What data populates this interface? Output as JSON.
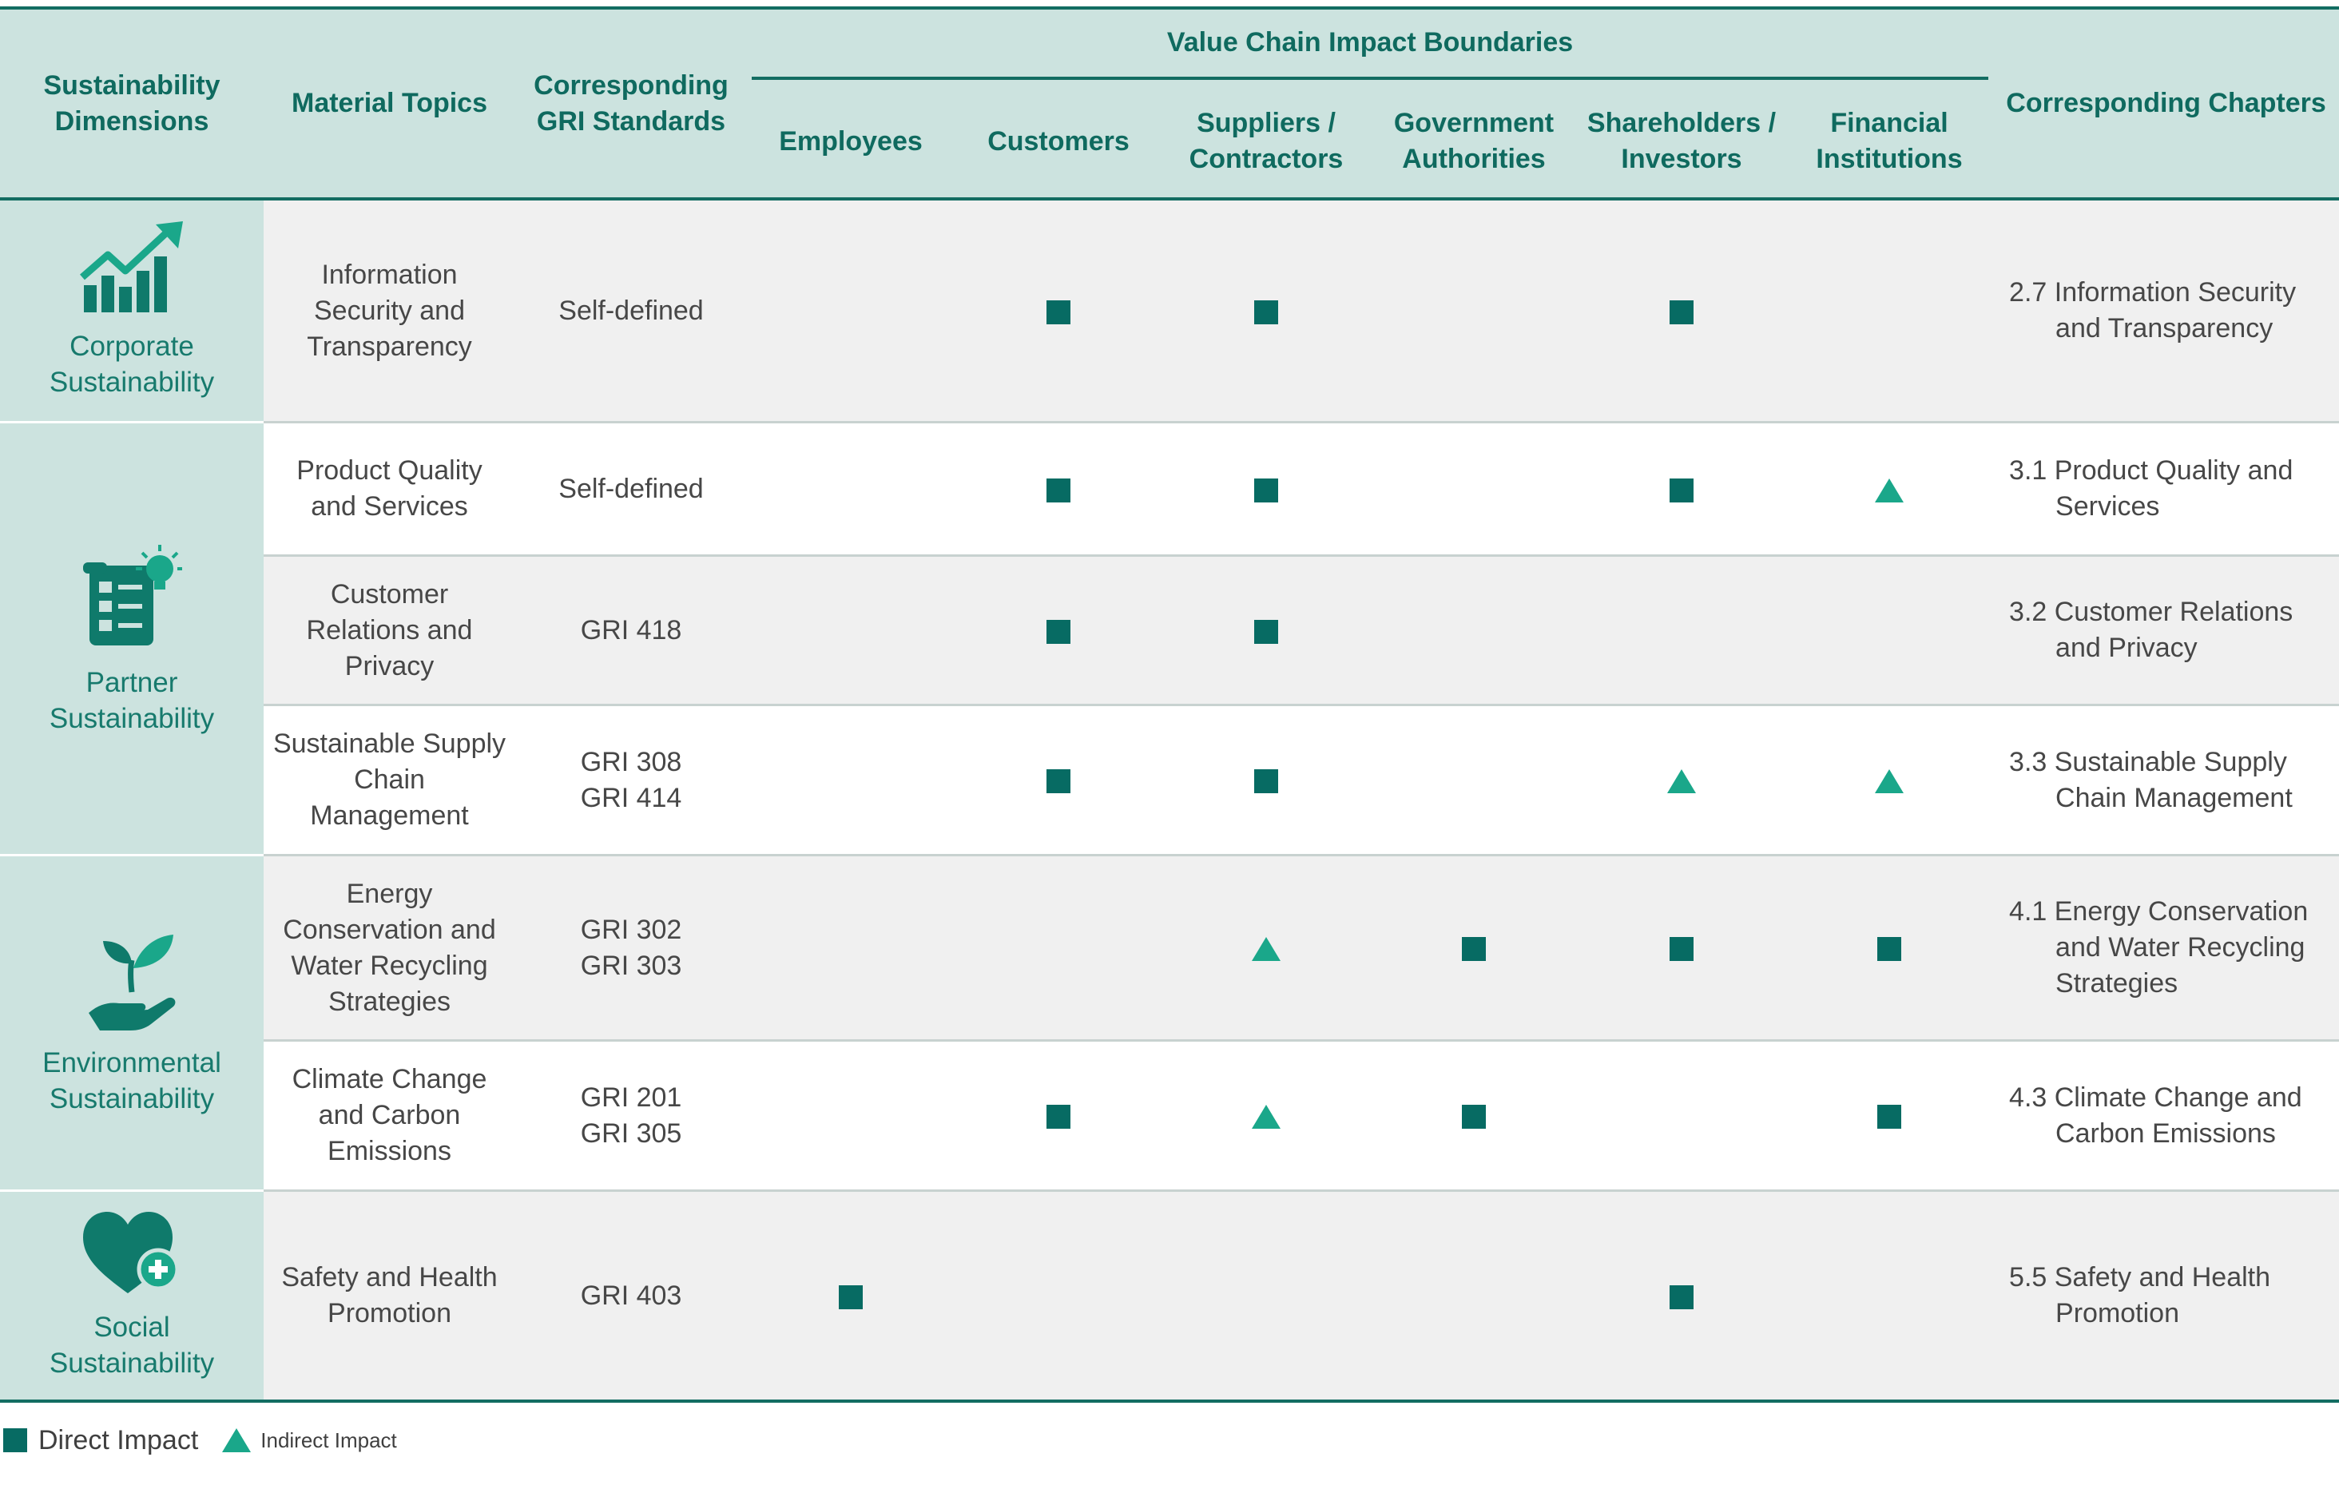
{
  "header": {
    "dimensions": "Sustainability Dimensions",
    "topics": "Material Topics",
    "gri": "Corresponding GRI Standards",
    "value_chain": "Value Chain Impact Boundaries",
    "employees": "Employees",
    "customers": "Customers",
    "suppliers": "Suppliers / Contractors",
    "government": "Government Authorities",
    "shareholders": "Shareholders / Investors",
    "financial": "Financial Institutions",
    "chapters": "Corresponding Chapters"
  },
  "dimensions": {
    "corporate": "Corporate Sustainability",
    "partner": "Partner Sustainability",
    "environmental": "Environmental Sustainability",
    "social": "Social Sustainability"
  },
  "rows": [
    {
      "topic": "Information Security and Transparency",
      "gri": "Self-defined",
      "chapter": "2.7 Information Security and Transparency",
      "impacts": [
        "",
        "direct",
        "direct",
        "",
        "direct",
        ""
      ]
    },
    {
      "topic": "Product Quality and Services",
      "gri": "Self-defined",
      "chapter": "3.1 Product Quality and Services",
      "impacts": [
        "",
        "direct",
        "direct",
        "",
        "direct",
        "indirect"
      ]
    },
    {
      "topic": "Customer Relations and Privacy",
      "gri": "GRI 418",
      "chapter": "3.2 Customer Relations and Privacy",
      "impacts": [
        "",
        "direct",
        "direct",
        "",
        "",
        ""
      ]
    },
    {
      "topic": "Sustainable Supply Chain Management",
      "gri": "GRI 308 GRI 414",
      "gri_lines": [
        "GRI 308",
        "GRI 414"
      ],
      "chapter": "3.3 Sustainable Supply Chain Management",
      "impacts": [
        "",
        "direct",
        "direct",
        "",
        "indirect",
        "indirect"
      ]
    },
    {
      "topic": "Energy Conservation and Water Recycling Strategies",
      "gri_lines": [
        "GRI 302",
        "GRI 303"
      ],
      "chapter": "4.1 Energy Conservation and Water Recycling Strategies",
      "impacts": [
        "",
        "",
        "indirect",
        "direct",
        "direct",
        "direct"
      ]
    },
    {
      "topic": "Climate Change and Carbon Emissions",
      "gri_lines": [
        "GRI 201",
        "GRI 305"
      ],
      "chapter": "4.3 Climate Change and Carbon Emissions",
      "impacts": [
        "",
        "direct",
        "indirect",
        "direct",
        "",
        "direct"
      ]
    },
    {
      "topic": "Safety and Health Promotion",
      "gri": "GRI 403",
      "chapter": "5.5 Safety and Health Promotion",
      "impacts": [
        "direct",
        "",
        "",
        "",
        "direct",
        ""
      ]
    }
  ],
  "legend": {
    "direct": "Direct Impact",
    "indirect": "Indirect Impact"
  },
  "colors": {
    "header_bg": "#cce3df",
    "accent_dark": "#076b63",
    "accent_light": "#1aa78a",
    "row_alt": "#f0f0f0"
  },
  "icons": {
    "corporate": "growth-chart-icon",
    "partner": "checklist-lightbulb-icon",
    "environmental": "hand-plant-icon",
    "social": "heart-plus-icon"
  }
}
